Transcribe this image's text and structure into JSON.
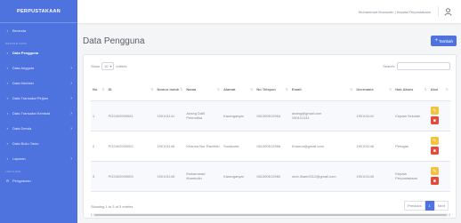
{
  "brand": "PERPUSTAKAAN",
  "sidebar": {
    "items": [
      {
        "label": "Beranda",
        "icon": "home-icon",
        "chevron": false,
        "active": false
      },
      {
        "heading": "MASTER DATA"
      },
      {
        "label": "Data Pengguna",
        "icon": "users-icon",
        "chevron": false,
        "active": true
      },
      {
        "label": "Data Anggota",
        "icon": "user-icon",
        "chevron": true,
        "active": false
      },
      {
        "label": "Data Member",
        "icon": "id-card-icon",
        "chevron": true,
        "active": false
      },
      {
        "label": "Data Transaksi Pinjam",
        "icon": "book-icon",
        "chevron": true,
        "active": false
      },
      {
        "label": "Data Transaksi Kembali",
        "icon": "book-icon",
        "chevron": true,
        "active": false
      },
      {
        "label": "Data Denda",
        "icon": "money-icon",
        "chevron": true,
        "active": false
      },
      {
        "label": "Data Buku Tamu",
        "icon": "guestbook-icon",
        "chevron": false,
        "active": false
      },
      {
        "label": "Laporan",
        "icon": "report-icon",
        "chevron": true,
        "active": false
      },
      {
        "heading": "LAIN-LAIN"
      },
      {
        "label": "Pengaturan",
        "icon": "gear-icon",
        "chevron": false,
        "active": false
      }
    ]
  },
  "topbar": {
    "user_name": "Muhammad Ilhamudin | Kepala Perpustakaan",
    "user_icon": "user-icon"
  },
  "main": {
    "title": "Data Pengguna",
    "add_button": "Tambah",
    "show_label": "Show",
    "show_value": "10",
    "entries_label": "entries",
    "search_label": "Search:"
  },
  "table": {
    "headers": [
      "No",
      "ID",
      "Nomor Induk",
      "Nama",
      "Alamat",
      "No Telepon",
      "Email",
      "Username",
      "Hak Akses",
      "Aksi"
    ],
    "rows": [
      [
        "1",
        "PG2402090001",
        "190101141",
        "Anang Dalil Petendika",
        "Karanganyar",
        "081390512964",
        "anang@gmail.com\n190101141",
        "190101141",
        "Kepala Sekolah"
      ],
      [
        "2",
        "PG2402090002",
        "190101146",
        "Khanna Nur Rachfah",
        "Surakarta",
        "081390512968",
        "Khanna@gmail.com",
        "190101146",
        "Petugas"
      ],
      [
        "3",
        "PG2402090003",
        "190101145",
        "Muhammad Ilhamudin",
        "Karanganyar",
        "081390512960",
        "muh.ilham2012@gmail.com",
        "190101145",
        "Kepala Perpustakaan"
      ]
    ]
  },
  "footer": {
    "info": "Showing 1 to 3 of 3 entries",
    "previous": "Previous",
    "page": "1",
    "next": "Next"
  }
}
